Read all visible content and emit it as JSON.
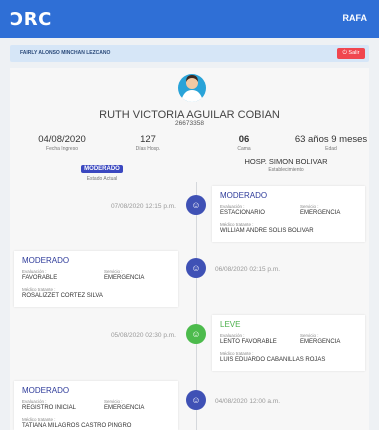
{
  "topbar": {
    "logo": "ƆRC",
    "user": "RAFA",
    "color": "#2f6fd6"
  },
  "userbar": {
    "name": "FAIRLY ALONSO MINCHAN LEZCANO",
    "exit_label": "⏻ Salir"
  },
  "patient": {
    "name": "RUTH VICTORIA AGUILAR COBIAN",
    "id": "26673358"
  },
  "stats": {
    "admission_date": {
      "value": "04/08/2020",
      "label": "Fecha Ingreso"
    },
    "days": {
      "value": "127",
      "label": "Días Hosp."
    },
    "bed": {
      "value": "06",
      "label": "Cama"
    },
    "age": {
      "value": "63 años 9 meses",
      "label": "Edad"
    },
    "status": {
      "value": "MODERADO",
      "label": "Estado Actual"
    },
    "facility": {
      "value": "HOSP. SIMON BOLIVAR",
      "label": "Establecimiento"
    }
  },
  "labels": {
    "evaluacion": "Evaluación :",
    "servicio": "Servicio :",
    "medico": "Médico tratante :"
  },
  "timeline": [
    {
      "title": "MODERADO",
      "date": "07/08/2020 12:15 p.m.",
      "evaluation": "ESTACIONARIO",
      "service": "EMERGENCIA",
      "doctor": "WILLIAM ANDRE SOLIS BOLIVAR",
      "color": "#3f51b5"
    },
    {
      "title": "MODERADO",
      "date": "06/08/2020 02:15 p.m.",
      "evaluation": "FAVORABLE",
      "service": "EMERGENCIA",
      "doctor": "ROSALIZZET CORTEZ SILVA",
      "color": "#3f51b5"
    },
    {
      "title": "LEVE",
      "date": "05/08/2020 02:30 p.m.",
      "evaluation": "LENTO FAVORABLE",
      "service": "EMERGENCIA",
      "doctor": "LUIS EDUARDO CABANILLAS ROJAS",
      "color": "#4cbb4c"
    },
    {
      "title": "MODERADO",
      "date": "04/08/2020 12:00 a.m.",
      "evaluation": "REGISTRO INICIAL",
      "service": "EMERGENCIA",
      "doctor": "TATIANA MILAGROS CASTRO PINGRO",
      "color": "#3f51b5"
    }
  ]
}
